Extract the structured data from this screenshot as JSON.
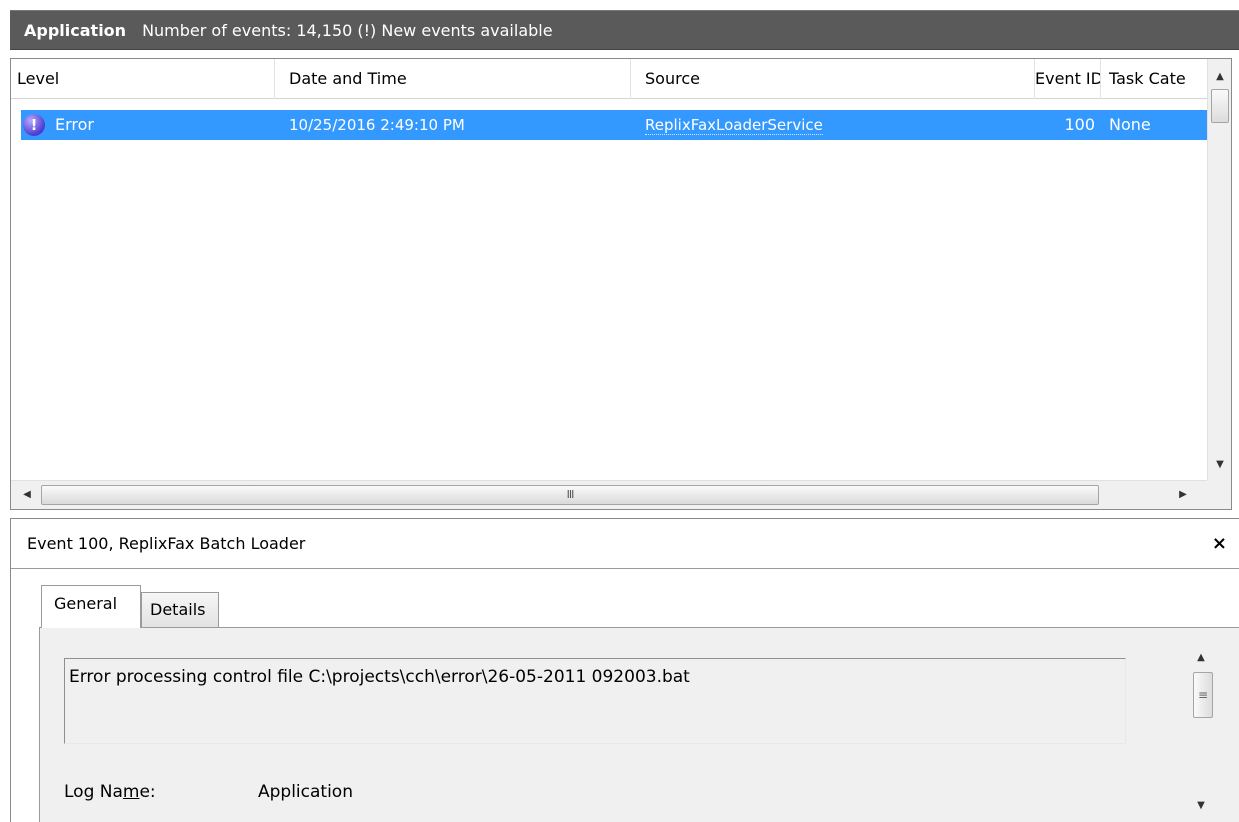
{
  "header": {
    "app_name": "Application",
    "summary": "Number of events: 14,150 (!) New events available"
  },
  "list": {
    "columns": [
      "Level",
      "Date and Time",
      "Source",
      "Event ID",
      "Task Cate"
    ],
    "rows": [
      {
        "level": "Error",
        "level_icon": "error-icon",
        "date": "10/25/2016 2:49:10 PM",
        "source": "ReplixFaxLoaderService",
        "event_id": "100",
        "task": "None"
      }
    ],
    "hscroll_grip": "III"
  },
  "detail": {
    "title": "Event 100, ReplixFax Batch Loader",
    "close_glyph": "×",
    "tabs": [
      "General",
      "Details"
    ],
    "message": "Error processing control file C:\\projects\\cch\\error\\26-05-2011 092003.bat",
    "log_name_label_pre": "Log Na",
    "log_name_label_u": "m",
    "log_name_label_post": "e:",
    "log_name_value": "Application"
  },
  "colors": {
    "header_bg": "#5a5a5a",
    "selection": "#3399ff"
  }
}
